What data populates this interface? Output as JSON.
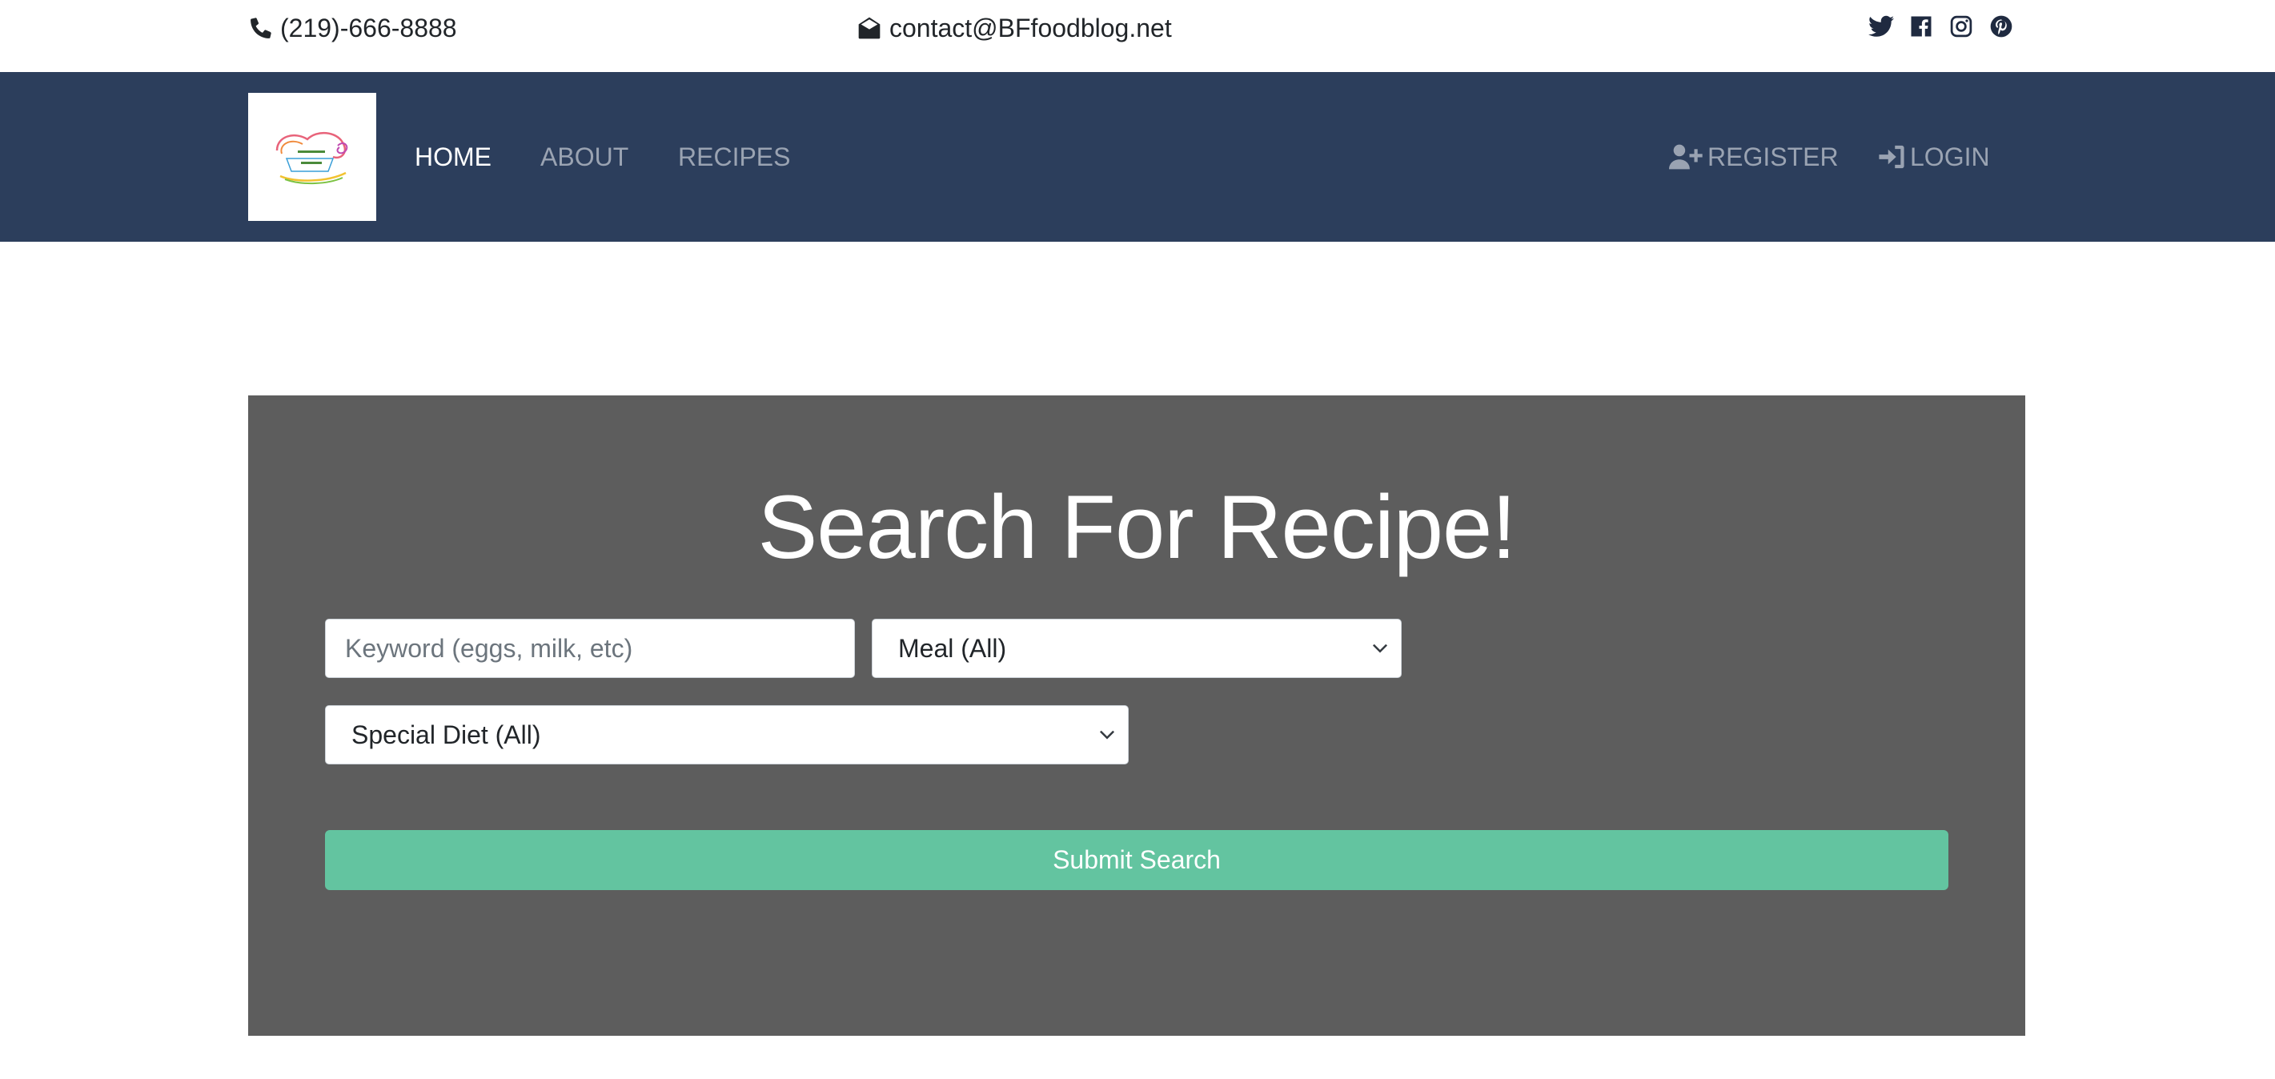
{
  "topbar": {
    "phone": "(219)-666-8888",
    "email": "contact@BFfoodblog.net",
    "social": [
      "twitter-icon",
      "facebook-icon",
      "instagram-icon",
      "pinterest-icon"
    ]
  },
  "nav": {
    "logo_alt": "Food with Bindra",
    "home": "HOME",
    "about": "ABOUT",
    "recipes": "RECIPES",
    "register": "REGISTER",
    "login": "LOGIN",
    "active": "HOME"
  },
  "search": {
    "title": "Search For Recipe!",
    "keyword_placeholder": "Keyword (eggs, milk, etc)",
    "meal_selected": "Meal (All)",
    "diet_selected": "Special Diet (All)",
    "submit_label": "Submit Search"
  },
  "colors": {
    "navbar_bg": "#2c3e5c",
    "panel_bg": "#5d5d5d",
    "submit_bg": "#63c4a0",
    "nav_active": "#ffffff",
    "nav_inactive": "#9aa3b2"
  }
}
